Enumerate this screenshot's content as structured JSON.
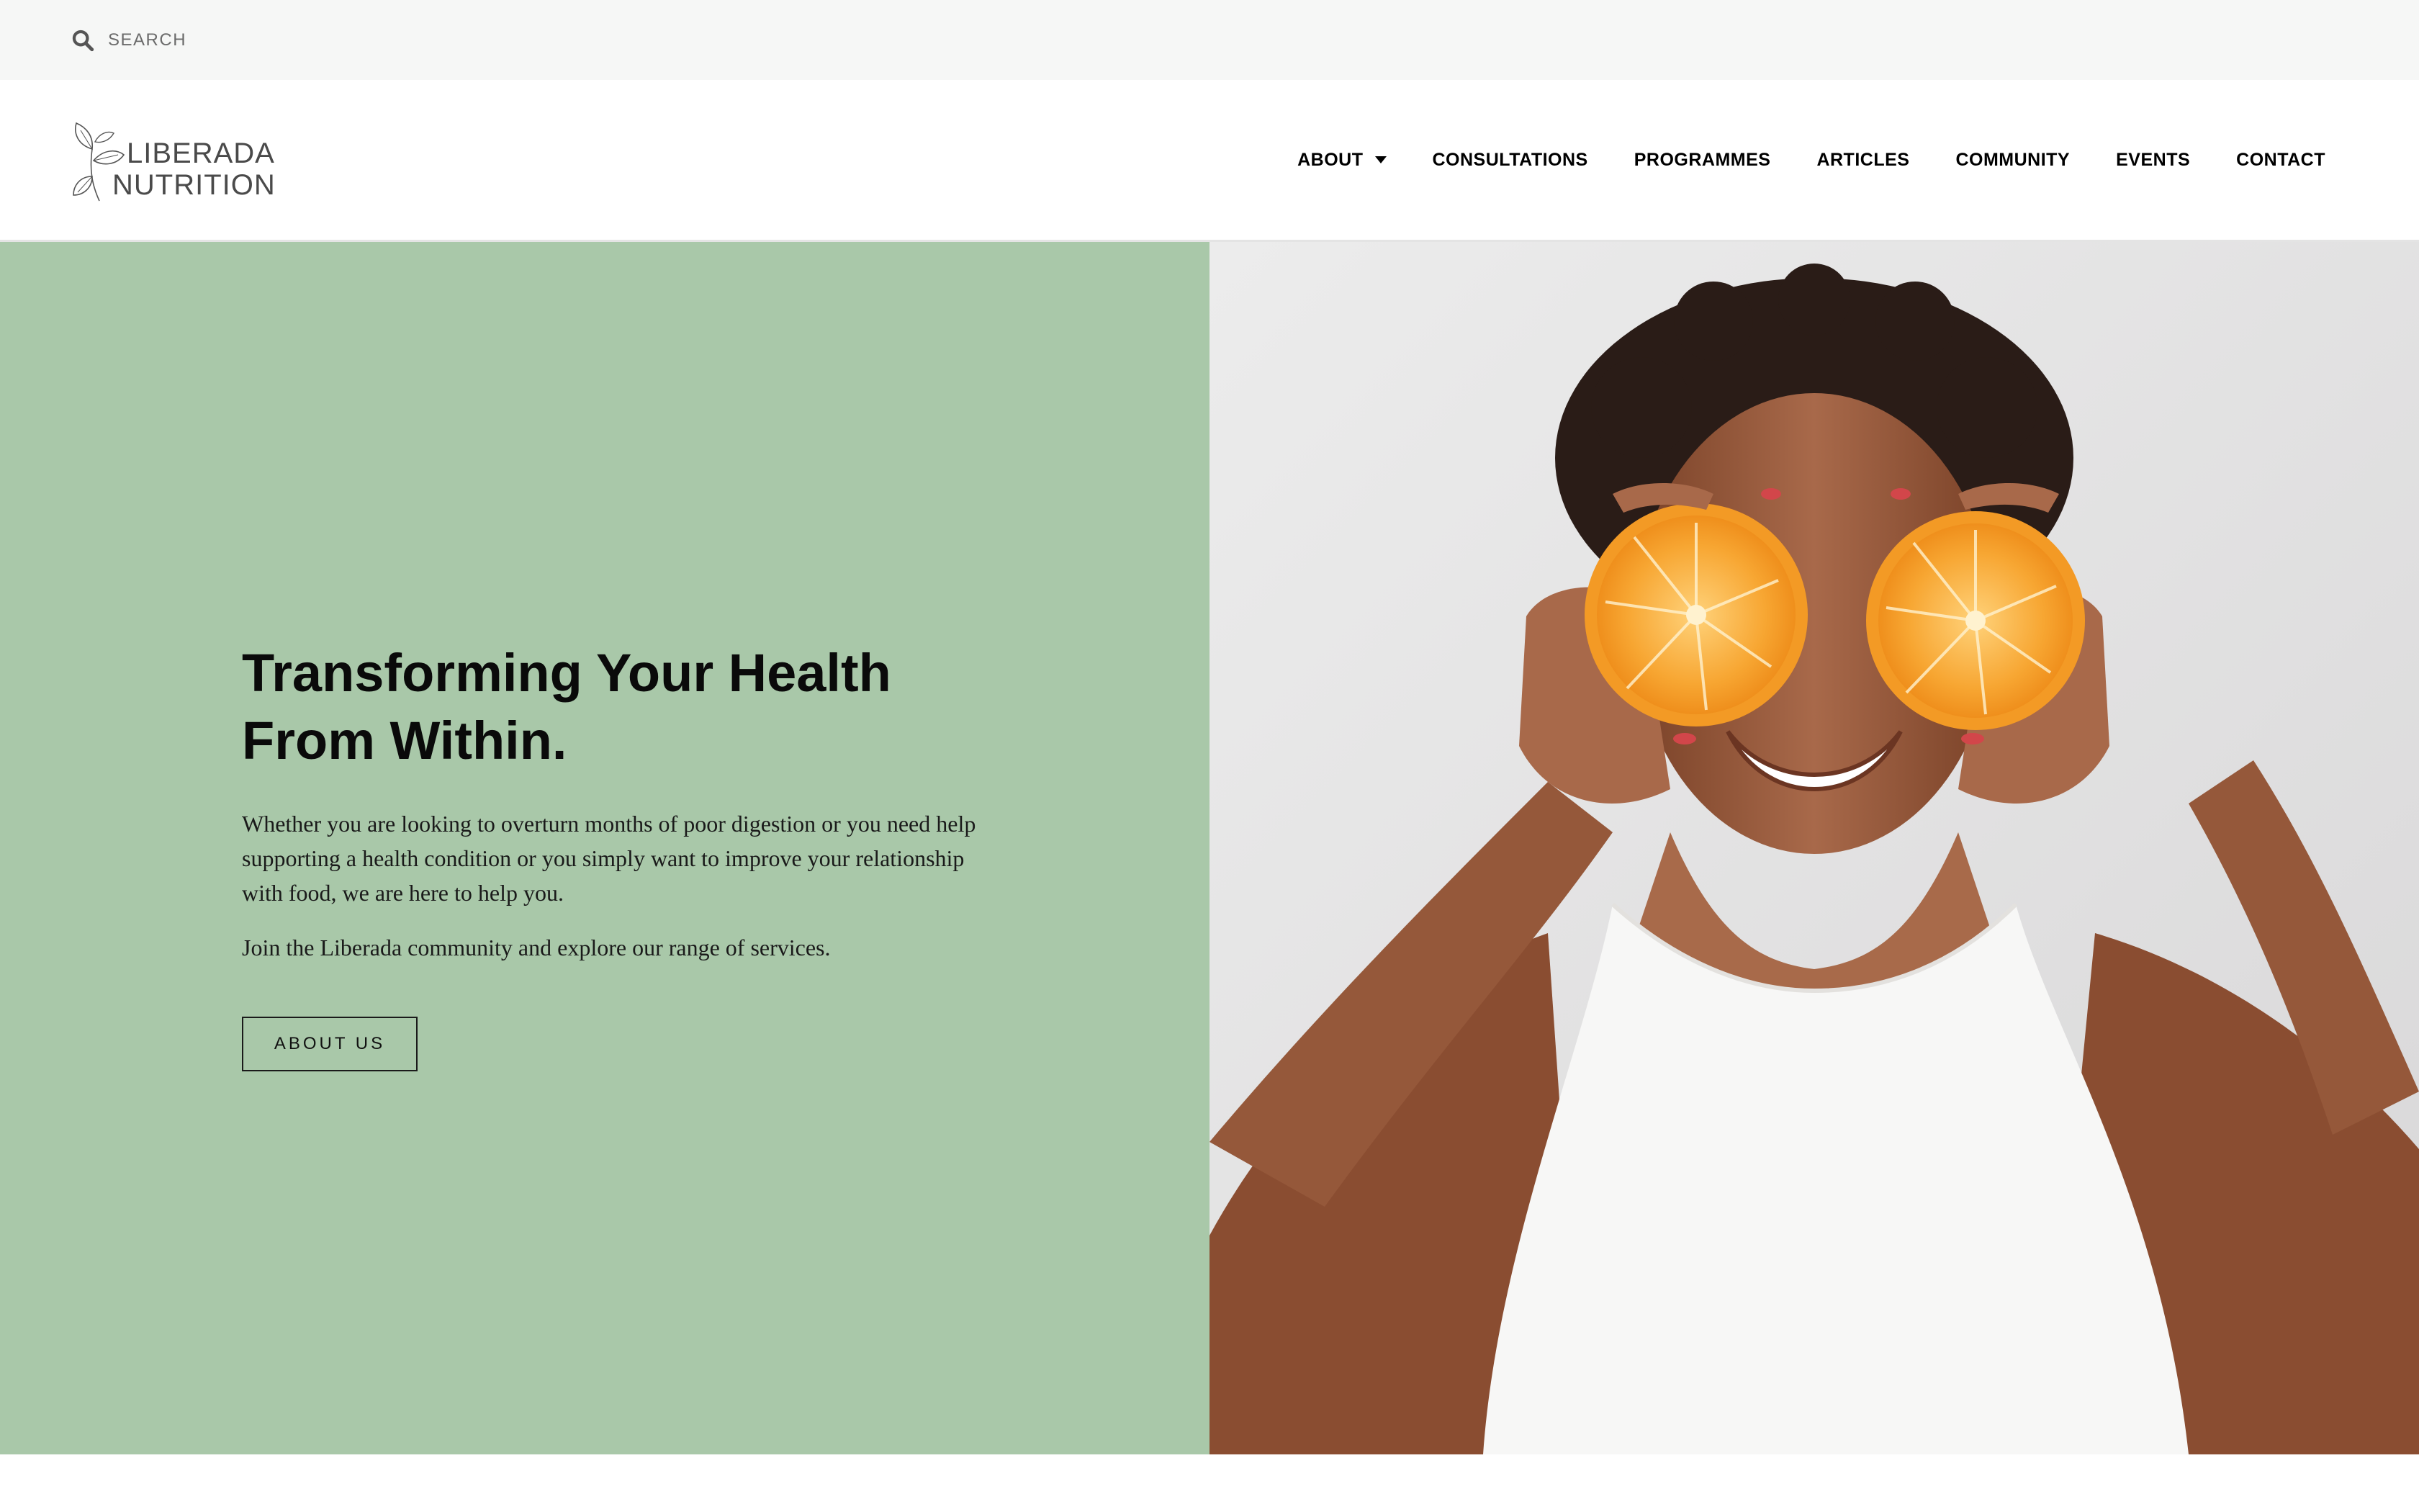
{
  "search": {
    "placeholder": "SEARCH"
  },
  "logo": {
    "line1": "LIBERADA",
    "line2": "NUTRITION"
  },
  "nav": {
    "items": [
      {
        "label": "ABOUT",
        "has_dropdown": true
      },
      {
        "label": "CONSULTATIONS"
      },
      {
        "label": "PROGRAMMES"
      },
      {
        "label": "ARTICLES"
      },
      {
        "label": "COMMUNITY"
      },
      {
        "label": "EVENTS"
      },
      {
        "label": "CONTACT"
      }
    ]
  },
  "hero": {
    "title": "Transforming Your Health From Within.",
    "paragraph1": "Whether you are looking to overturn months of poor digestion or you need help supporting a health condition or you simply want to improve your relationship with food, we are here to help you.",
    "paragraph2": "Join the Liberada community and explore our range of services.",
    "button_label": "ABOUT US"
  },
  "colors": {
    "hero_green": "#a9c8a9",
    "topbar_bg": "#f6f7f6",
    "orange": "#f5a530",
    "skin": "#9a5c3c"
  },
  "icons": {
    "search": "search-icon",
    "caret": "chevron-down-icon",
    "logo": "leaf-icon"
  }
}
